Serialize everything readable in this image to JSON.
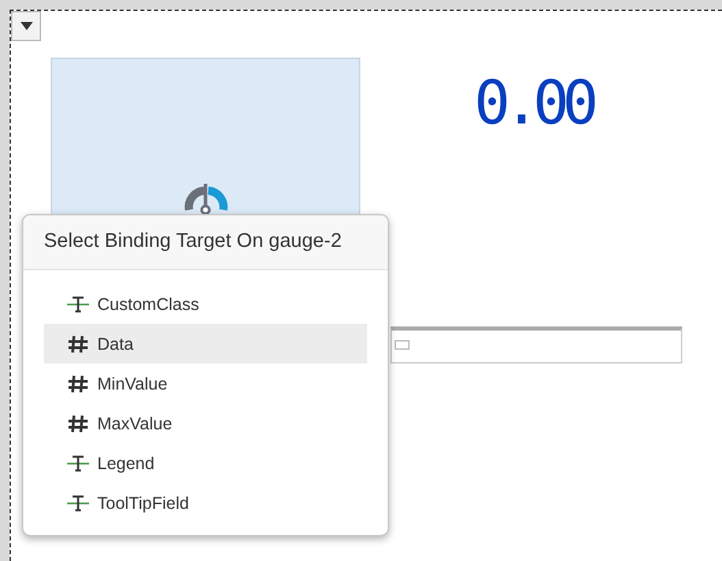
{
  "canvas": {
    "readout": "0.00",
    "slider": {
      "level": 0
    }
  },
  "popup": {
    "title": "Select Binding Target On gauge-2",
    "items": [
      {
        "label": "CustomClass",
        "kind": "text",
        "selected": false
      },
      {
        "label": "Data",
        "kind": "number",
        "selected": true
      },
      {
        "label": "MinValue",
        "kind": "number",
        "selected": false
      },
      {
        "label": "MaxValue",
        "kind": "number",
        "selected": false
      },
      {
        "label": "Legend",
        "kind": "text",
        "selected": false
      },
      {
        "label": "ToolTipField",
        "kind": "text",
        "selected": false
      }
    ]
  }
}
